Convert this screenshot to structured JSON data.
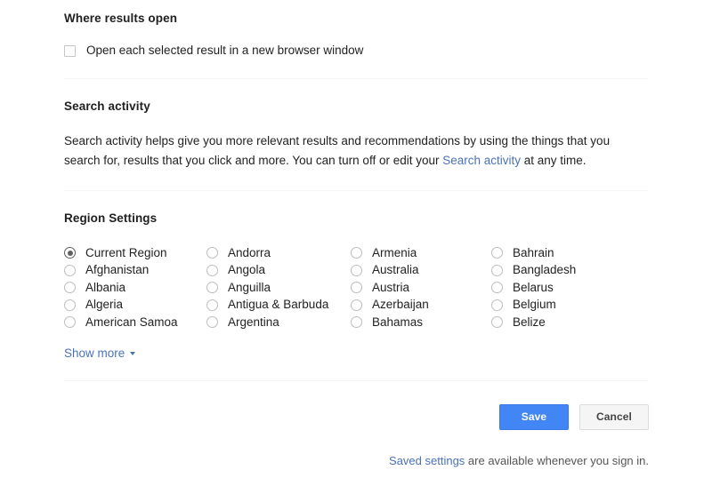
{
  "sections": {
    "where_results_open": {
      "title": "Where results open",
      "checkbox": {
        "label": "Open each selected result in a new browser window",
        "checked": false
      }
    },
    "search_activity": {
      "title": "Search activity",
      "paragraph_part1": "Search activity helps give you more relevant results and recommendations by using the things that you search for, results that you click and more. You can turn off or edit your ",
      "paragraph_link": "Search activity",
      "paragraph_part2": " at any time."
    },
    "region_settings": {
      "title": "Region Settings",
      "selected": "Current Region",
      "columns": [
        {
          "options": [
            "Current Region",
            "Afghanistan",
            "Albania",
            "Algeria",
            "American Samoa"
          ]
        },
        {
          "options": [
            "Andorra",
            "Angola",
            "Anguilla",
            "Antigua & Barbuda",
            "Argentina"
          ]
        },
        {
          "options": [
            "Armenia",
            "Australia",
            "Austria",
            "Azerbaijan",
            "Bahamas"
          ]
        },
        {
          "options": [
            "Bahrain",
            "Bangladesh",
            "Belarus",
            "Belgium",
            "Belize"
          ]
        }
      ],
      "show_more": "Show more"
    }
  },
  "actions": {
    "save_label": "Save",
    "cancel_label": "Cancel"
  },
  "footer": {
    "link": "Saved settings",
    "text": " are available whenever you sign in."
  },
  "colors": {
    "accent_blue": "#4285f4",
    "link_blue": "#4a72b8",
    "divider": "#f4f5f7",
    "cancel_bg": "#f5f5f5"
  }
}
